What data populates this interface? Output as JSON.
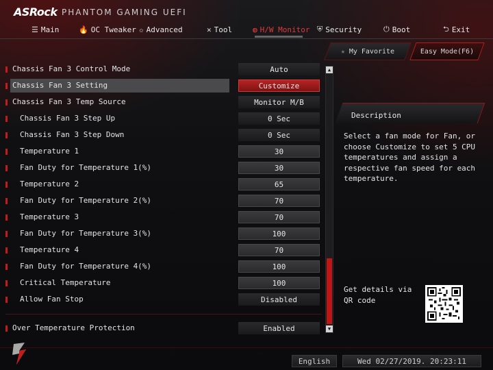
{
  "app": {
    "brand": "ASRock",
    "subtitle": "PHANTOM GAMING UEFI"
  },
  "nav": {
    "items": [
      {
        "label": "Main",
        "icon": "list-icon"
      },
      {
        "label": "OC Tweaker",
        "icon": "flame-icon"
      },
      {
        "label": "Advanced",
        "icon": "star-icon"
      },
      {
        "label": "Tool",
        "icon": "tool-icon"
      },
      {
        "label": "H/W Monitor",
        "icon": "monitor-icon",
        "active": true
      },
      {
        "label": "Security",
        "icon": "shield-icon"
      },
      {
        "label": "Boot",
        "icon": "power-icon"
      },
      {
        "label": "Exit",
        "icon": "exit-icon"
      }
    ]
  },
  "buttons": {
    "favorite": "My Favorite",
    "easy_mode": "Easy Mode(F6)"
  },
  "settings": [
    {
      "label": "Chassis Fan 3 Control Mode",
      "value": "Auto",
      "sub": false
    },
    {
      "label": "Chassis Fan 3 Setting",
      "value": "Customize",
      "sub": false,
      "selected": true
    },
    {
      "label": "Chassis Fan 3 Temp Source",
      "value": "Monitor M/B",
      "sub": false
    },
    {
      "label": "Chassis Fan 3 Step Up",
      "value": "0 Sec",
      "sub": true
    },
    {
      "label": "Chassis Fan 3 Step Down",
      "value": "0 Sec",
      "sub": true
    },
    {
      "label": "Temperature 1",
      "value": "30",
      "sub": true,
      "dim": true
    },
    {
      "label": "Fan Duty for Temperature 1(%)",
      "value": "30",
      "sub": true,
      "dim": true
    },
    {
      "label": "Temperature 2",
      "value": "65",
      "sub": true,
      "dim": true
    },
    {
      "label": "Fan Duty for Temperature 2(%)",
      "value": "70",
      "sub": true,
      "dim": true
    },
    {
      "label": "Temperature 3",
      "value": "70",
      "sub": true,
      "dim": true
    },
    {
      "label": "Fan Duty for Temperature 3(%)",
      "value": "100",
      "sub": true,
      "dim": true
    },
    {
      "label": "Temperature 4",
      "value": "70",
      "sub": true,
      "dim": true
    },
    {
      "label": "Fan Duty for Temperature 4(%)",
      "value": "100",
      "sub": true,
      "dim": true
    },
    {
      "label": "Critical Temperature",
      "value": "100",
      "sub": true,
      "dim": true
    },
    {
      "label": "Allow Fan Stop",
      "value": "Disabled",
      "sub": true
    },
    {
      "label": "Over Temperature Protection",
      "value": "Enabled",
      "sub": false
    }
  ],
  "description": {
    "title": "Description",
    "text": "Select a fan mode for Fan, or choose Customize to set 5 CPU temperatures and assign a respective fan speed for each temperature."
  },
  "qr": {
    "text": "Get details via QR code"
  },
  "footer": {
    "language": "English",
    "datetime": "Wed 02/27/2019. 20:23:11"
  },
  "colors": {
    "accent": "#c51b1b",
    "active_nav": "#e0393a",
    "selected_value": "#b72424"
  }
}
